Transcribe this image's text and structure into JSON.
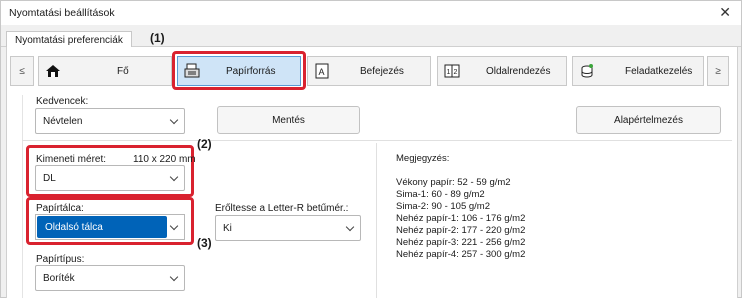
{
  "window": {
    "title": "Nyomtatási beállítások"
  },
  "tabs": {
    "active": "Nyomtatási preferenciák"
  },
  "nav": {
    "prev": "≤",
    "next": "≥",
    "items": [
      {
        "label": "Fő",
        "icon": "home-icon"
      },
      {
        "label": "Papírforrás",
        "icon": "paper-tray-icon"
      },
      {
        "label": "Befejezés",
        "icon": "document-a-icon"
      },
      {
        "label": "Oldalrendezés",
        "icon": "page-layout-icon"
      },
      {
        "label": "Feladatkezelés",
        "icon": "job-stack-icon"
      }
    ]
  },
  "callouts": {
    "c1": "(1)",
    "c2": "(2)",
    "c3": "(3)",
    "color": "#d9222f"
  },
  "favorites": {
    "label": "Kedvencek:",
    "value": "Névtelen",
    "save_button": "Mentés",
    "default_button": "Alapértelmezés"
  },
  "output_size": {
    "label": "Kimeneti méret:",
    "dimension": "110 x 220 mm",
    "value": "DL"
  },
  "paper_tray": {
    "label": "Papírtálca:",
    "value": "Oldalsó tálca"
  },
  "force_letter": {
    "label": "Erőltesse a Letter-R betűmér.:",
    "value": "Ki"
  },
  "paper_type": {
    "label": "Papírtípus:",
    "value": "Boríték"
  },
  "notes": {
    "title": "Megjegyzés:",
    "lines": [
      "Vékony papír: 52 - 59 g/m2",
      "Sima-1: 60 - 89 g/m2",
      "Sima-2: 90 - 105 g/m2",
      "Nehéz papír-1: 106 - 176 g/m2",
      "Nehéz papír-2: 177 - 220 g/m2",
      "Nehéz papír-3: 221 - 256 g/m2",
      "Nehéz papír-4: 257 - 300 g/m2"
    ]
  },
  "colors": {
    "selected_tab_bg": "#cfe4f7",
    "highlight_select": "#0063b8"
  }
}
